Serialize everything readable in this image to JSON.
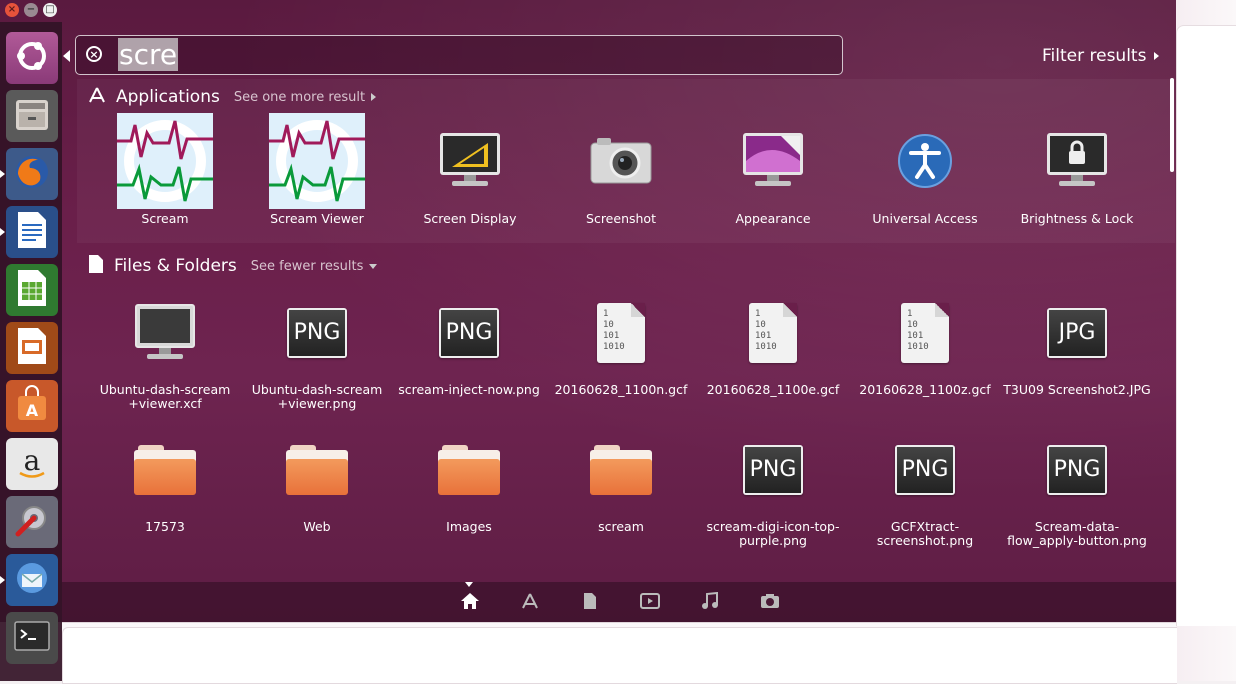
{
  "search": {
    "query": "scre"
  },
  "filter": {
    "label": "Filter results"
  },
  "sections": {
    "applications": {
      "title": "Applications",
      "more": "See one more result"
    },
    "files": {
      "title": "Files & Folders",
      "more": "See fewer results"
    }
  },
  "apps": [
    {
      "label": "Scream"
    },
    {
      "label": "Scream Viewer"
    },
    {
      "label": "Screen Display"
    },
    {
      "label": "Screenshot"
    },
    {
      "label": "Appearance"
    },
    {
      "label": "Universal Access"
    },
    {
      "label": "Brightness & Lock"
    }
  ],
  "files_row1": [
    {
      "label": "Ubuntu-dash-scream +viewer.xcf"
    },
    {
      "label": "Ubuntu-dash-scream +viewer.png",
      "badge": "PNG"
    },
    {
      "label": "scream-inject-now.png",
      "badge": "PNG"
    },
    {
      "label": "20160628_1100n.gcf"
    },
    {
      "label": "20160628_1100e.gcf"
    },
    {
      "label": "20160628_1100z.gcf"
    },
    {
      "label": "T3U09 Screenshot2.JPG",
      "badge": "JPG"
    }
  ],
  "files_row2": [
    {
      "label": "17573"
    },
    {
      "label": "Web"
    },
    {
      "label": "Images"
    },
    {
      "label": "scream"
    },
    {
      "label": "scream-digi-icon-top-purple.png",
      "badge": "PNG"
    },
    {
      "label": "GCFXtract-screenshot.png",
      "badge": "PNG"
    },
    {
      "label": "Scream-data-flow_apply-button.png",
      "badge": "PNG"
    }
  ],
  "gcf_icon_text": [
    "1",
    "10",
    "101",
    "1010"
  ],
  "window_controls": {
    "close": "×",
    "minimize": "−",
    "maximize": "□"
  },
  "colors": {
    "accent": "#dd4814",
    "dash_bg": "#6a1f4a"
  }
}
